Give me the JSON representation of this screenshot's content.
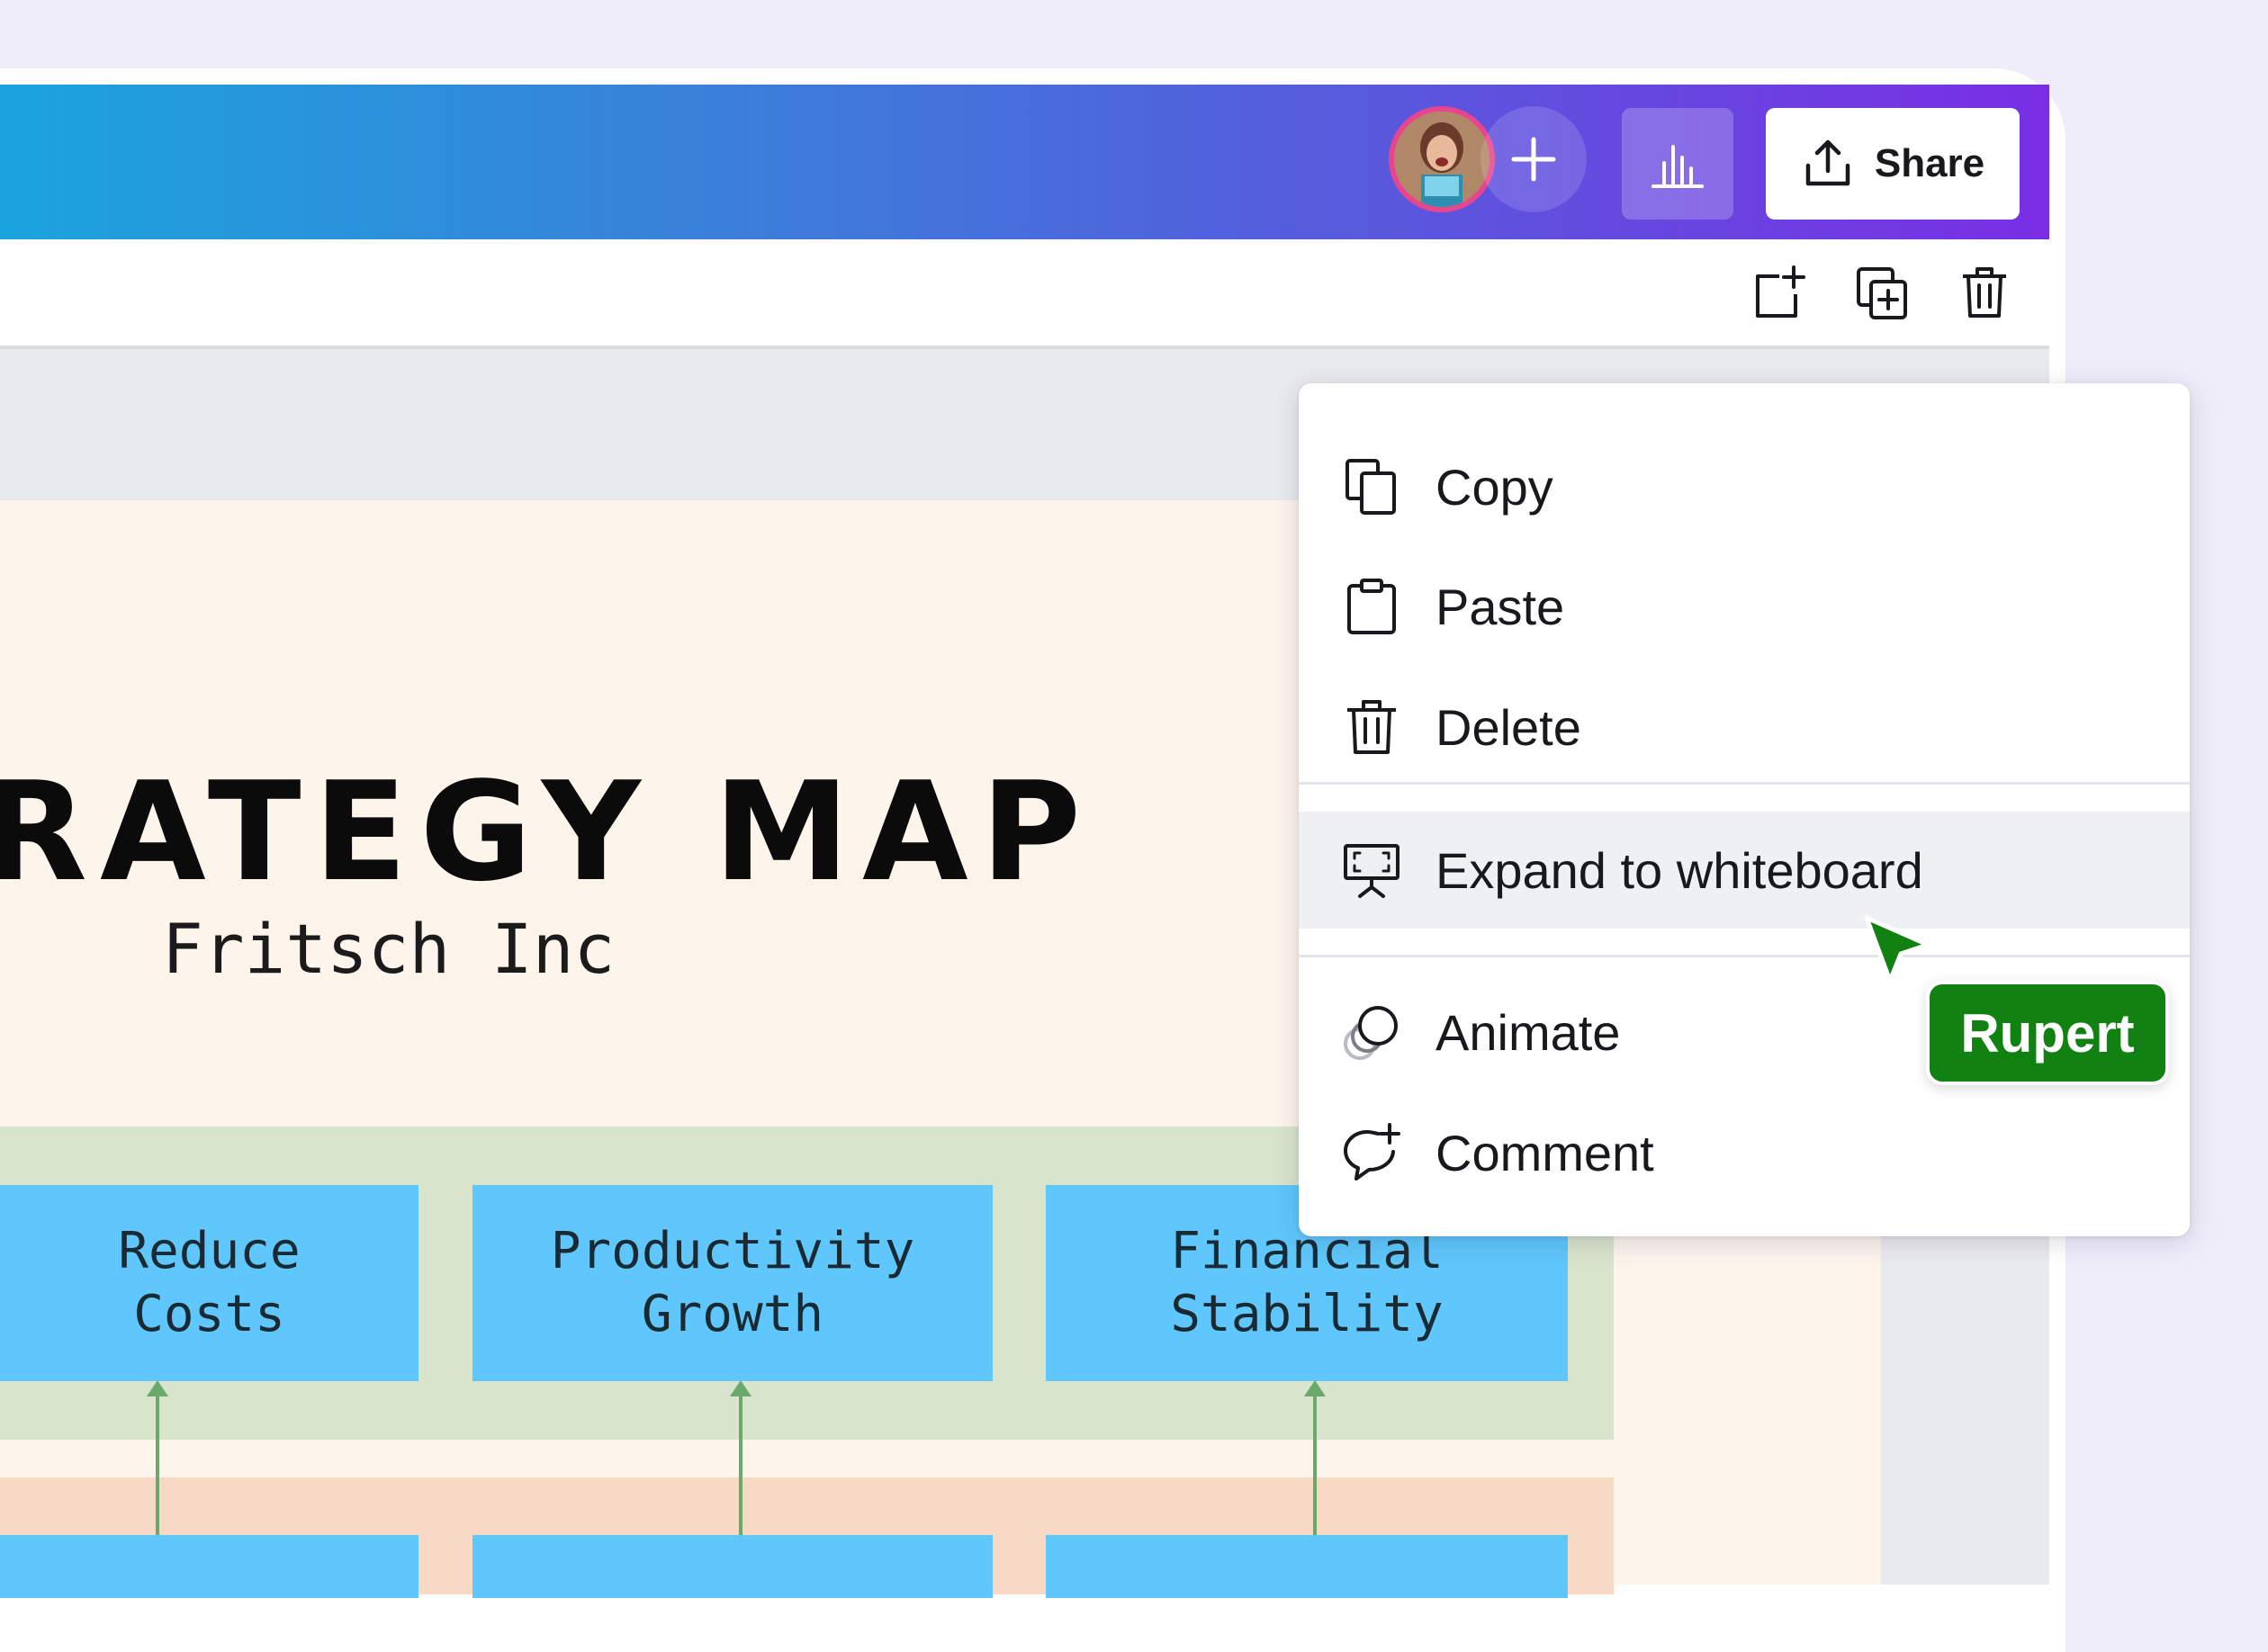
{
  "header": {
    "share_label": "Share",
    "add_collaborator_icon": "plus-icon",
    "analytics_icon": "bar-chart-icon",
    "share_icon": "upload-icon",
    "avatar": "user-avatar"
  },
  "page_toolbar": {
    "icons": [
      "add-page-icon",
      "duplicate-page-icon",
      "trash-icon"
    ]
  },
  "design": {
    "title": "RATEGY MAP",
    "subtitle": "Fritsch Inc",
    "boxes": [
      {
        "label": "Reduce\nCosts"
      },
      {
        "label": "Productivity\nGrowth"
      },
      {
        "label": "Financial\nStability"
      }
    ]
  },
  "context_menu": {
    "items": [
      {
        "label": "Copy",
        "icon": "copy-icon"
      },
      {
        "label": "Paste",
        "icon": "clipboard-icon"
      },
      {
        "label": "Delete",
        "icon": "trash-icon"
      },
      {
        "label": "Expand to whiteboard",
        "icon": "whiteboard-icon"
      },
      {
        "label": "Animate",
        "icon": "animate-icon"
      },
      {
        "label": "Comment",
        "icon": "comment-add-icon"
      }
    ]
  },
  "collaborator_cursor": {
    "name": "Rupert",
    "color": "#118212"
  },
  "colors": {
    "topbar_start": "#1ba4dd",
    "topbar_end": "#7a2ee4",
    "box": "#5fc7fb",
    "avatar_ring": "#e8458f"
  }
}
